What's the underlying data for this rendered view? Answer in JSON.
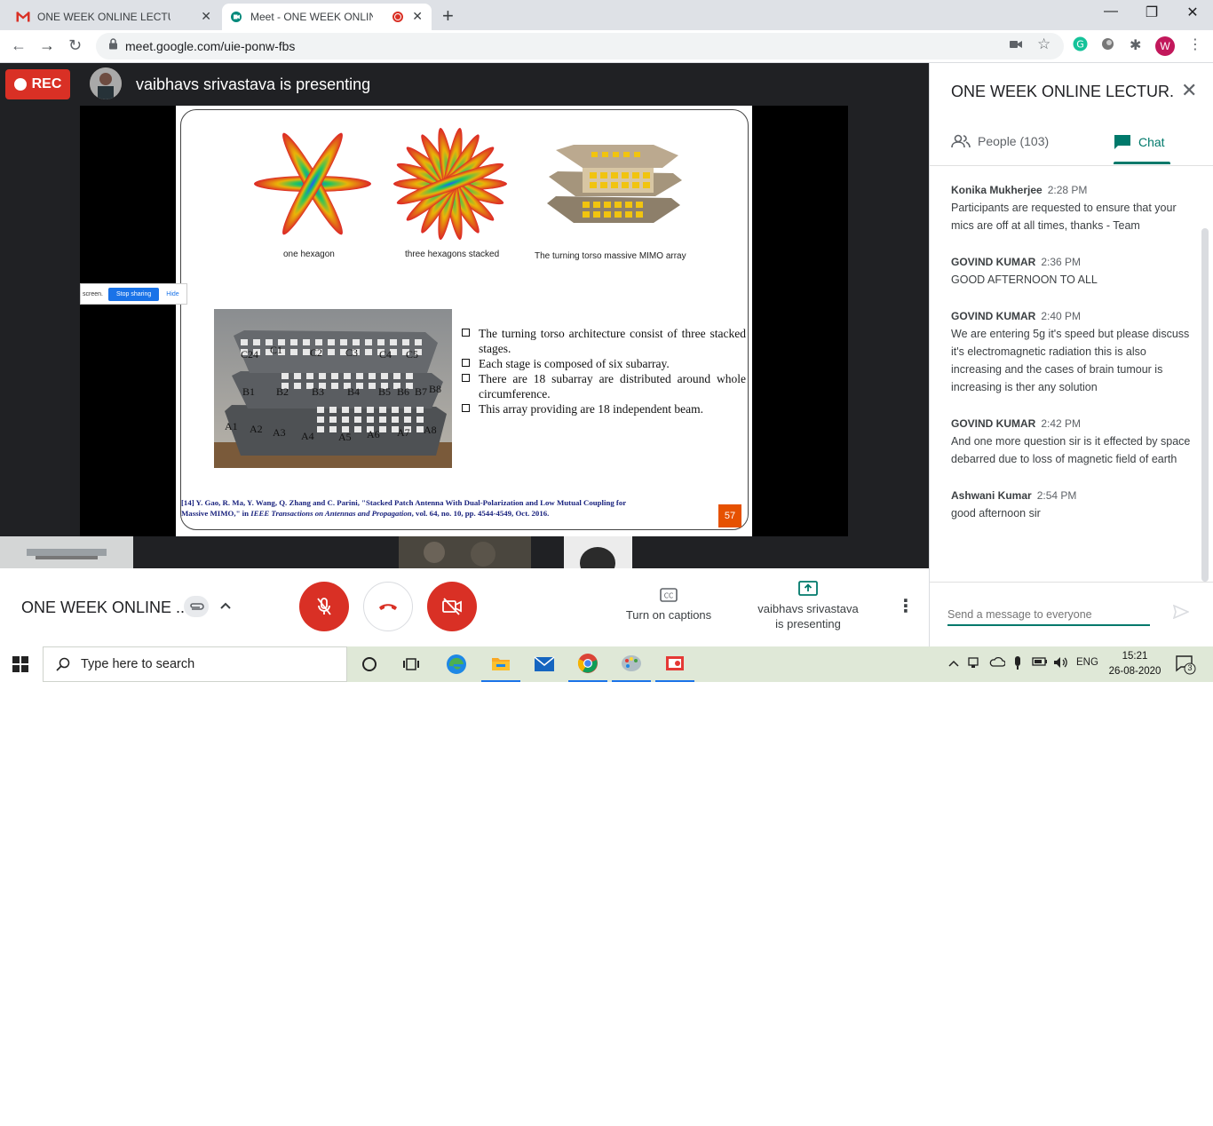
{
  "browser": {
    "tabs": [
      {
        "title": "ONE WEEK ONLINE LECTURE SER",
        "favicon": "gmail-icon"
      },
      {
        "title": "Meet - ONE WEEK ONLINE L",
        "favicon": "meet-icon",
        "recording": true
      }
    ],
    "url": "meet.google.com/uie-ponw-fbs",
    "profile_initial": "W"
  },
  "meet": {
    "rec_label": "REC",
    "presenter_banner": "vaibhavs srivastava is presenting",
    "slide": {
      "captions": [
        "one hexagon",
        "three hexagons  stacked",
        "The turning torso massive MIMO array"
      ],
      "bullets": [
        "The turning torso architecture consist of three stacked stages.",
        "Each stage is composed of six subarray.",
        "There are 18 subarray are distributed around whole circumference.",
        "This array providing  are 18 independent beam."
      ],
      "array_labels": {
        "top": [
          "C24",
          "C1",
          "C2",
          "C3",
          "C4",
          "C5"
        ],
        "middle": [
          "B1",
          "B2",
          "B3",
          "B4",
          "B5",
          "B6",
          "B7",
          "B8"
        ],
        "bottom": [
          "A1",
          "A2",
          "A3",
          "A4",
          "A5",
          "A6",
          "A7",
          "A8"
        ]
      },
      "reference_line1": "[14] Y. Gao, R. Ma, Y. Wang, Q. Zhang and C. Parini, \"Stacked Patch Antenna With Dual-Polarization and Low Mutual Coupling for",
      "reference_line2_a": "Massive MIMO,\" in ",
      "reference_line2_journal": "IEEE Transactions on Antennas and Propagation",
      "reference_line2_b": ", vol. 64, no. 10, pp. 4544-4549, Oct. 2016.",
      "page_number": "57"
    },
    "share_bar": {
      "screen_text": "screen.",
      "stop_label": "Stop sharing",
      "hide_label": "Hide"
    }
  },
  "bottom_bar": {
    "meeting_name": "ONE WEEK ONLINE ...",
    "captions_label": "Turn on captions",
    "presenting_line1": "vaibhavs srivastava",
    "presenting_line2": "is presenting"
  },
  "panel": {
    "title": "ONE WEEK ONLINE LECTUR...",
    "people_tab": "People (103)",
    "chat_tab": "Chat",
    "messages": [
      {
        "sender": "Konika Mukherjee",
        "time": "2:28 PM",
        "text": "Participants are requested to ensure that your mics are off at all times, thanks - Team"
      },
      {
        "sender": "GOVIND KUMAR",
        "time": "2:36 PM",
        "text": "GOOD AFTERNOON TO ALL"
      },
      {
        "sender": "GOVIND KUMAR",
        "time": "2:40 PM",
        "text": "We are entering 5g it's speed but please discuss it's electromagnetic radiation this is also increasing and the cases of brain tumour is increasing is ther any solution"
      },
      {
        "sender": "GOVIND KUMAR",
        "time": "2:42 PM",
        "text": "And  one more question sir is it effected by space debarred due to loss of magnetic field of earth"
      },
      {
        "sender": "Ashwani Kumar",
        "time": "2:54 PM",
        "text": "good afternoon sir"
      }
    ],
    "composer_placeholder": "Send a message to everyone"
  },
  "taskbar": {
    "search_placeholder": "Type here to search",
    "language": "ENG",
    "time": "15:21",
    "date": "26-08-2020",
    "notification_count": "3"
  }
}
